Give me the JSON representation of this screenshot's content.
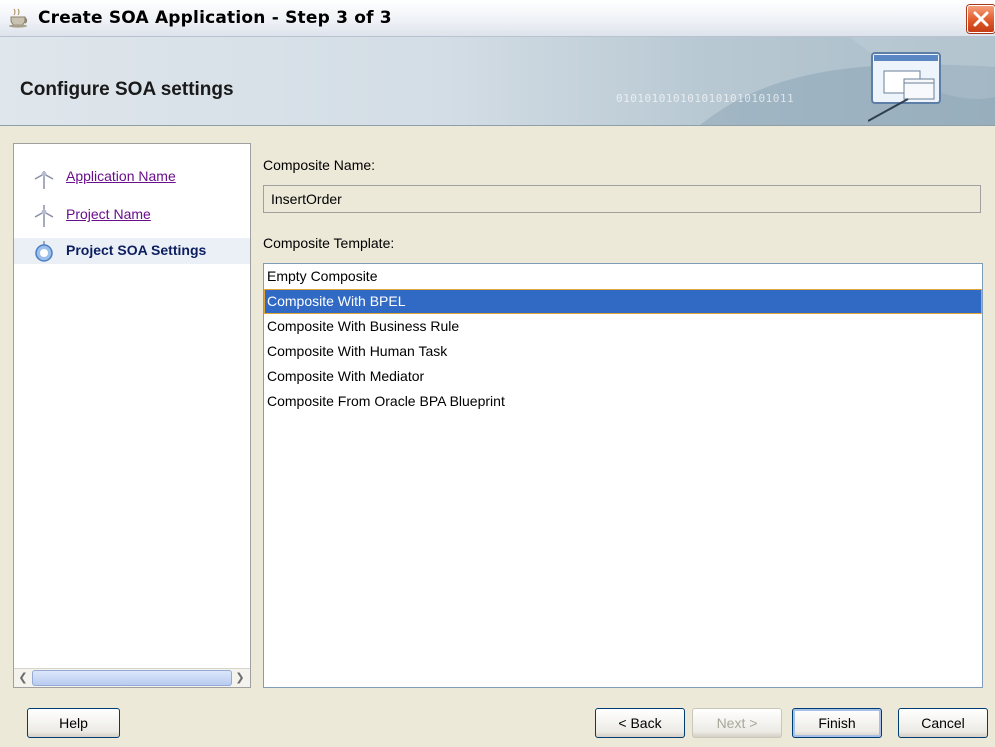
{
  "window": {
    "title": "Create SOA Application - Step 3 of 3"
  },
  "header": {
    "title": "Configure SOA settings",
    "binary_decoration": "0101010101010101010101011"
  },
  "nav": {
    "items": [
      {
        "label": "Application Name",
        "state": "completed"
      },
      {
        "label": "Project Name",
        "state": "completed"
      },
      {
        "label": "Project SOA Settings",
        "state": "current"
      }
    ]
  },
  "form": {
    "composite_name_label": "Composite Name:",
    "composite_name_value": "InsertOrder",
    "composite_template_label": "Composite Template:",
    "templates": [
      "Empty Composite",
      "Composite With BPEL",
      "Composite With Business Rule",
      "Composite With Human Task",
      "Composite With Mediator",
      "Composite From Oracle BPA Blueprint"
    ],
    "selected_template_index": 1
  },
  "buttons": {
    "help": "Help",
    "back": "< Back",
    "next": "Next >",
    "finish": "Finish",
    "cancel": "Cancel"
  },
  "colors": {
    "selection": "#316ac5",
    "link": "#6a0e8c",
    "close_button": "#e15a2b"
  }
}
